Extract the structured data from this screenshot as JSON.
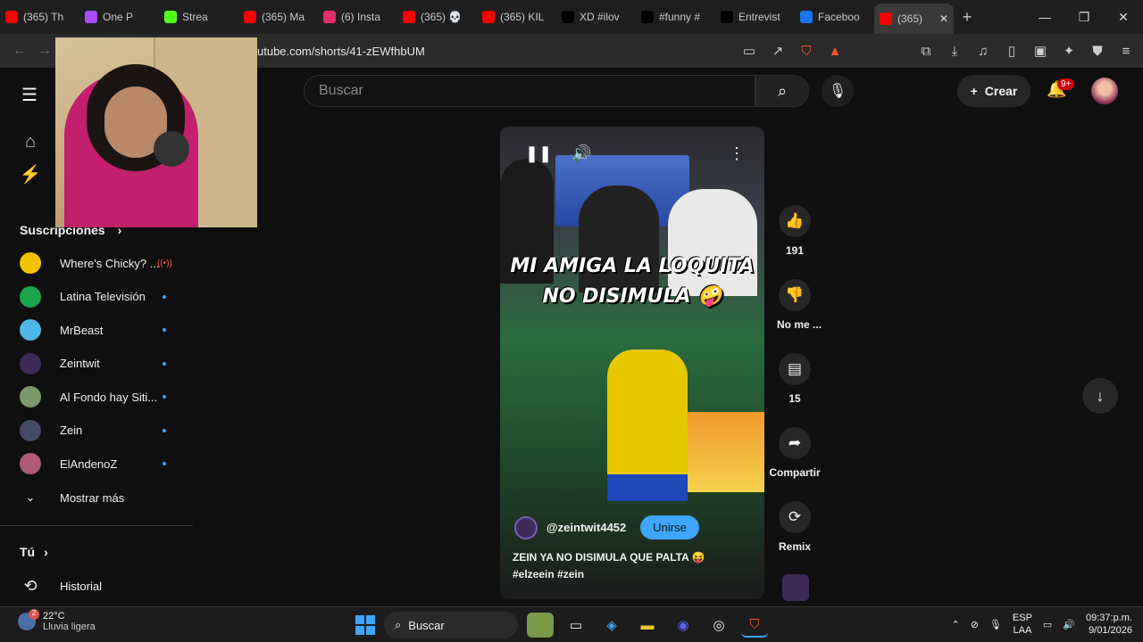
{
  "browser": {
    "tabs": [
      {
        "label": "(365) Th",
        "color": "#ff0000"
      },
      {
        "label": "One P",
        "color": "#a64dff"
      },
      {
        "label": "Strea",
        "color": "#53fc18"
      },
      {
        "label": "(365) Ma",
        "color": "#ff0000"
      },
      {
        "label": "(6) Insta",
        "color": "#e1306c"
      },
      {
        "label": "(365) 💀",
        "color": "#ff0000"
      },
      {
        "label": "(365) KIL",
        "color": "#ff0000"
      },
      {
        "label": "XD #ilov",
        "color": "#000000"
      },
      {
        "label": "#funny #",
        "color": "#000000"
      },
      {
        "label": "Entrevist",
        "color": "#000000"
      },
      {
        "label": "Faceboo",
        "color": "#1877f2"
      },
      {
        "label": "(365)",
        "color": "#ff0000",
        "active": true
      }
    ],
    "new_tab": "+",
    "url": "utube.com/shorts/41-zEWfhbUM"
  },
  "youtube": {
    "search_placeholder": "Buscar",
    "create_label": "Crear",
    "notif_badge": "9+",
    "subscriptions_title": "Suscripciones",
    "subscriptions": [
      {
        "name": "Where's Chicky? ...",
        "color": "#f5c200",
        "live": true
      },
      {
        "name": "Latina Televisión",
        "color": "#1aa54b",
        "live": false
      },
      {
        "name": "MrBeast",
        "color": "#4db6e8",
        "live": false
      },
      {
        "name": "Zeintwit",
        "color": "#3c2a58",
        "live": false
      },
      {
        "name": "Al Fondo hay Siti...",
        "color": "#7a9a6a",
        "live": false
      },
      {
        "name": "Zein",
        "color": "#444a6a",
        "live": false
      },
      {
        "name": "ElAndenoZ",
        "color": "#b05a7a",
        "live": false
      }
    ],
    "show_more": "Mostrar más",
    "you_title": "Tú",
    "history": "Historial",
    "short": {
      "caption_line1": "MI AMIGA LA LOQUITA",
      "caption_line2": "NO DISIMULA 🤪",
      "channel": "@zeintwit4452",
      "join": "Unirse",
      "desc_line1": "ZEIN YA NO DISIMULA QUE PALTA 😝",
      "desc_line2": "#elzeein #zein",
      "progress_fraction": 0.17
    },
    "actions": {
      "likes": "191",
      "dislike": "No me ...",
      "comments": "15",
      "share": "Compartir",
      "remix": "Remix"
    }
  },
  "taskbar": {
    "weather_temp": "22°C",
    "weather_desc": "Lluvia ligera",
    "weather_badge": "2",
    "search": "Buscar",
    "lang1": "ESP",
    "lang2": "LAA",
    "time": "09:37:p.m.",
    "date": "9/01/2026"
  }
}
